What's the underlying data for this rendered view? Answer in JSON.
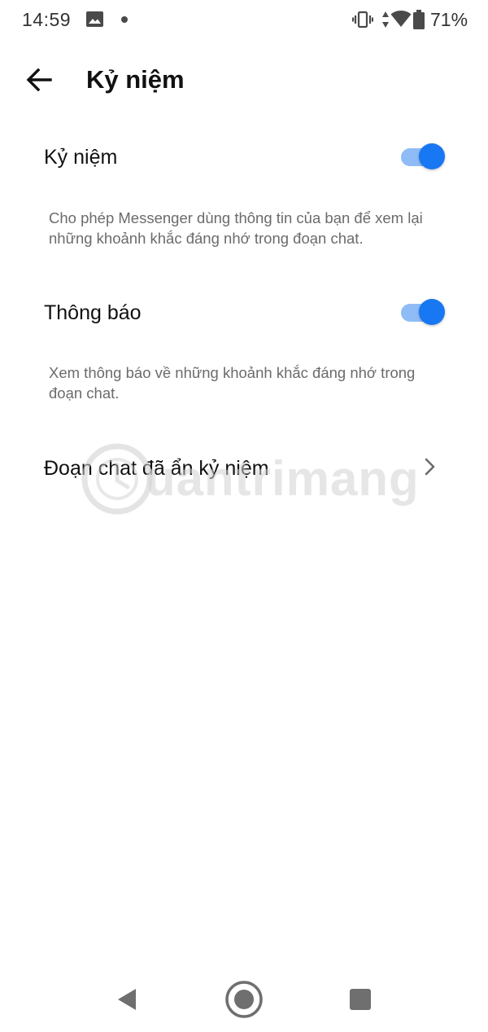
{
  "status_bar": {
    "time": "14:59",
    "battery": "71%",
    "icons": [
      "gallery-icon",
      "notification-dot-icon",
      "vibrate-icon",
      "mobile-data-icon",
      "wifi-icon",
      "battery-icon"
    ]
  },
  "header": {
    "back_icon": "arrow-left-icon",
    "title": "Kỷ niệm"
  },
  "settings": [
    {
      "label": "Kỷ niệm",
      "description": "Cho phép Messenger dùng thông tin của bạn để xem lại những khoảnh khắc đáng nhớ trong đoạn chat.",
      "toggle_on": true
    },
    {
      "label": "Thông báo",
      "description": "Xem thông báo về những khoảnh khắc đáng nhớ trong đoạn chat.",
      "toggle_on": true
    }
  ],
  "link_row": {
    "label": "Đoạn chat đã ẩn kỷ niệm",
    "icon": "chevron-right-icon"
  },
  "colors": {
    "accent": "#1877f2",
    "toggle_track": "#8fbcf7",
    "description_text": "#6b6b6b"
  },
  "navigation_bar": {
    "icons": [
      "back-triangle-icon",
      "home-circle-icon",
      "recents-square-icon"
    ]
  }
}
